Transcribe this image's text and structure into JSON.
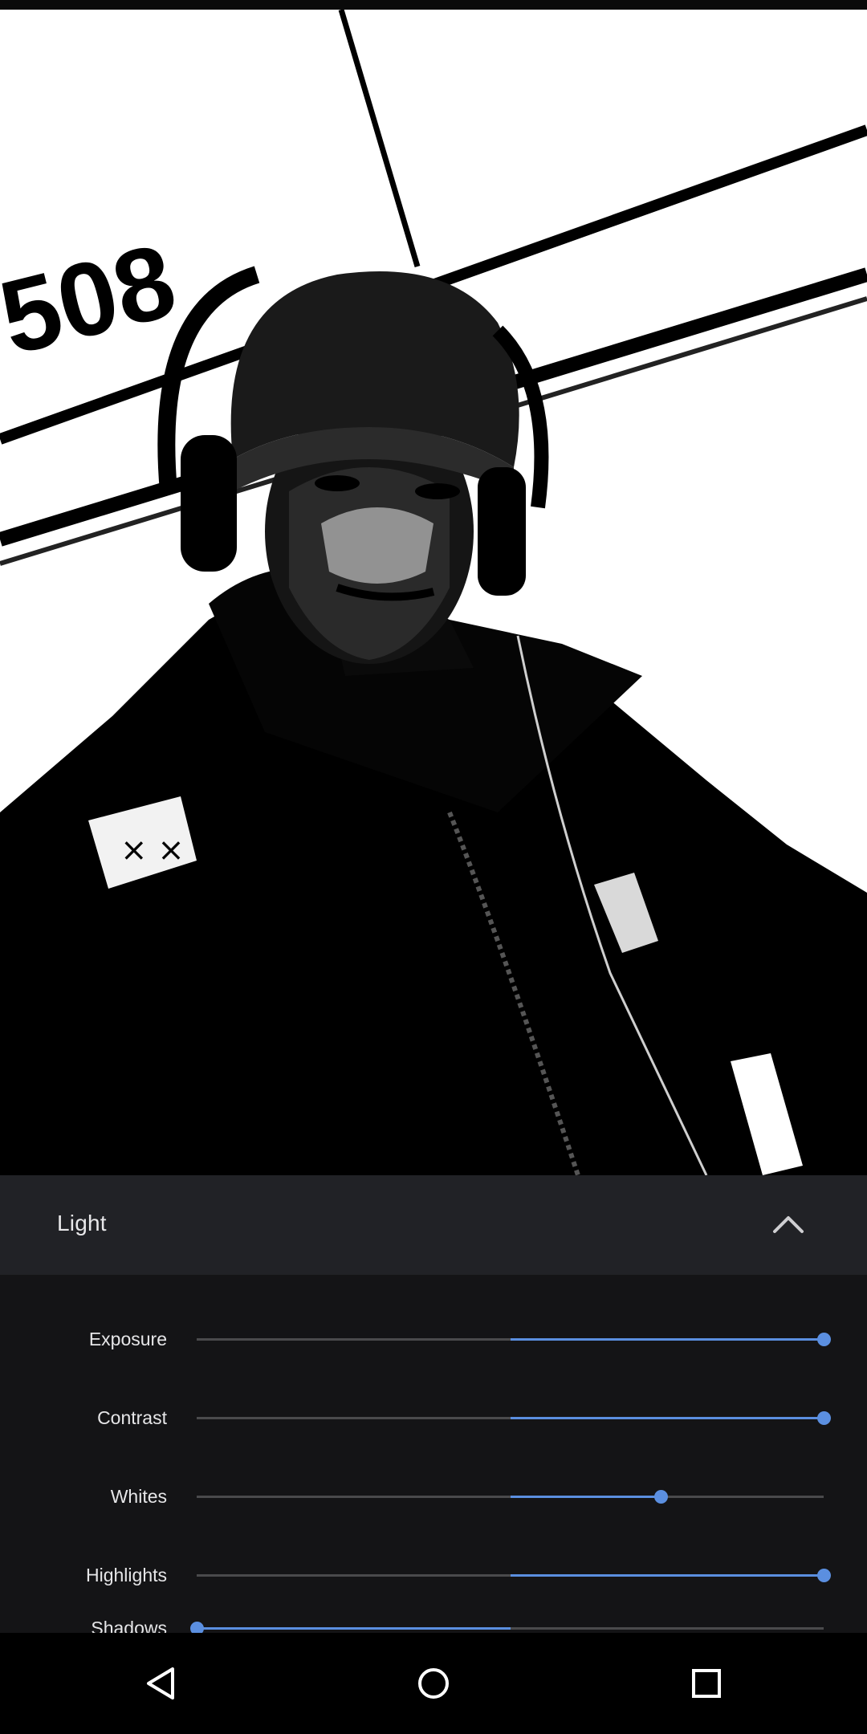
{
  "photo": {
    "wall_text": "508",
    "description_icon": "photo-preview"
  },
  "panel": {
    "title": "Light",
    "collapse_icon": "chevron-up-icon"
  },
  "sliders": [
    {
      "label": "Exposure",
      "value": 1.0
    },
    {
      "label": "Contrast",
      "value": 1.0
    },
    {
      "label": "Whites",
      "value": 0.74
    },
    {
      "label": "Highlights",
      "value": 1.0
    },
    {
      "label": "Shadows",
      "value": 0.0
    }
  ],
  "navbar": {
    "back_icon": "back-triangle-icon",
    "home_icon": "home-circle-icon",
    "recents_icon": "recents-square-icon"
  },
  "colors": {
    "accent": "#5b8fe0",
    "panel_header": "#212226",
    "panel_bg": "#141416",
    "track": "#4a4a4c"
  }
}
